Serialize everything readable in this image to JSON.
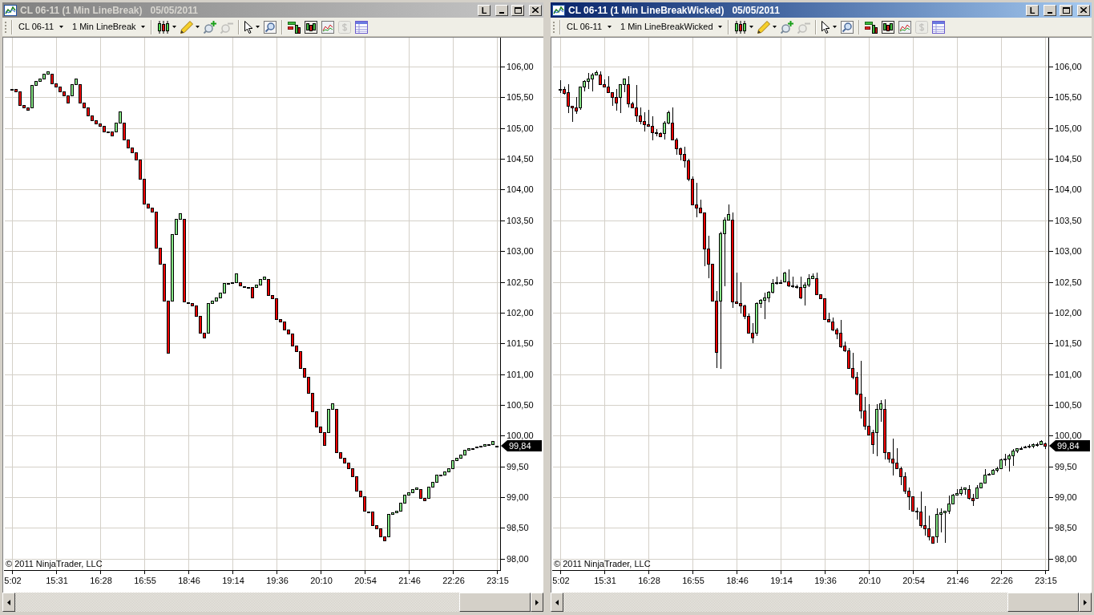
{
  "windows": [
    {
      "active": false,
      "title": "CL 06-11 (1 Min LineBreak)",
      "date": "05/05/2011",
      "caption_button": "L",
      "toolbar": {
        "instrument": "CL 06-11",
        "period": "1 Min LineBreak",
        "tool_groups": [
          [
            {
              "kind": "candles",
              "dropdown": true,
              "disabled": false
            },
            {
              "kind": "pencil",
              "dropdown": true,
              "disabled": false
            },
            {
              "kind": "zoom-in",
              "dropdown": false,
              "disabled": false
            },
            {
              "kind": "zoom-out",
              "dropdown": false,
              "disabled": true
            }
          ],
          [
            {
              "kind": "pointer",
              "dropdown": true,
              "disabled": false
            },
            {
              "kind": "data-box",
              "dropdown": false,
              "disabled": false
            }
          ],
          [
            {
              "kind": "indicators",
              "dropdown": false,
              "disabled": false
            },
            {
              "kind": "strategies",
              "dropdown": false,
              "disabled": false
            },
            {
              "kind": "chart-image",
              "dropdown": false,
              "disabled": false
            },
            {
              "kind": "dollar",
              "dropdown": false,
              "disabled": true
            },
            {
              "kind": "properties",
              "dropdown": false,
              "disabled": false
            }
          ]
        ]
      },
      "chart_data": [
        {
          "type": "candlestick",
          "grid": true,
          "ylim": [
            97.8,
            106.47
          ],
          "yticks": [
            {
              "value": 98,
              "label": "98,00"
            },
            {
              "value": 98.5,
              "label": "98,50"
            },
            {
              "value": 99,
              "label": "99,00"
            },
            {
              "value": 99.5,
              "label": "99,50"
            },
            {
              "value": 100,
              "label": "100,00"
            },
            {
              "value": 100.5,
              "label": "100,50"
            },
            {
              "value": 101,
              "label": "101,00"
            },
            {
              "value": 101.5,
              "label": "101,50"
            },
            {
              "value": 102,
              "label": "102,00"
            },
            {
              "value": 102.5,
              "label": "102,50"
            },
            {
              "value": 103,
              "label": "103,00"
            },
            {
              "value": 103.5,
              "label": "103,50"
            },
            {
              "value": 104,
              "label": "104,00"
            },
            {
              "value": 104.5,
              "label": "104,50"
            },
            {
              "value": 105,
              "label": "105,00"
            },
            {
              "value": 105.5,
              "label": "105,50"
            },
            {
              "value": 106,
              "label": "106,00"
            }
          ],
          "categories": [
            "5:02",
            null,
            null,
            null,
            null,
            null,
            null,
            null,
            null,
            null,
            null,
            "15:31",
            null,
            null,
            null,
            null,
            null,
            null,
            null,
            null,
            null,
            null,
            "16:28",
            null,
            null,
            null,
            null,
            null,
            null,
            null,
            null,
            null,
            null,
            "16:55",
            null,
            null,
            null,
            null,
            null,
            null,
            null,
            null,
            null,
            null,
            "18:46",
            null,
            null,
            null,
            null,
            null,
            null,
            null,
            null,
            null,
            null,
            "19:14",
            null,
            null,
            null,
            null,
            null,
            null,
            null,
            null,
            null,
            null,
            "19:36",
            null,
            null,
            null,
            null,
            null,
            null,
            null,
            null,
            null,
            null,
            "20:10",
            null,
            null,
            null,
            null,
            null,
            null,
            null,
            null,
            null,
            null,
            "20:54",
            null,
            null,
            null,
            null,
            null,
            null,
            null,
            null,
            null,
            null,
            "21:46",
            null,
            null,
            null,
            null,
            null,
            null,
            null,
            null,
            null,
            null,
            "22:26",
            null,
            null,
            null,
            null,
            null,
            null,
            null,
            null,
            null,
            null,
            "23:15"
          ],
          "ohlc": [
            [
              105.64,
              105.64,
              105.64,
              105.64
            ],
            [
              105.64,
              105.64,
              105.59,
              105.59
            ],
            [
              105.59,
              105.59,
              105.37,
              105.37
            ],
            [
              105.37,
              105.37,
              105.34,
              105.34
            ],
            [
              105.34,
              105.34,
              105.3,
              105.3
            ],
            [
              105.34,
              105.7,
              105.34,
              105.7
            ],
            [
              105.7,
              105.77,
              105.7,
              105.77
            ],
            [
              105.77,
              105.81,
              105.77,
              105.81
            ],
            [
              105.81,
              105.88,
              105.81,
              105.88
            ],
            [
              105.88,
              105.92,
              105.88,
              105.92
            ],
            [
              105.88,
              105.88,
              105.73,
              105.73
            ],
            [
              105.73,
              105.73,
              105.68,
              105.68
            ],
            [
              105.68,
              105.68,
              105.59,
              105.59
            ],
            [
              105.59,
              105.59,
              105.53,
              105.53
            ],
            [
              105.53,
              105.53,
              105.42,
              105.42
            ],
            [
              105.53,
              105.72,
              105.53,
              105.72
            ],
            [
              105.72,
              105.81,
              105.72,
              105.81
            ],
            [
              105.72,
              105.72,
              105.41,
              105.41
            ],
            [
              105.41,
              105.41,
              105.34,
              105.34
            ],
            [
              105.34,
              105.34,
              105.21,
              105.21
            ],
            [
              105.21,
              105.21,
              105.13,
              105.13
            ],
            [
              105.13,
              105.13,
              105.07,
              105.07
            ],
            [
              105.07,
              105.07,
              105.03,
              105.03
            ],
            [
              105.03,
              105.03,
              104.95,
              104.95
            ],
            [
              104.95,
              104.95,
              104.95,
              104.95
            ],
            [
              104.94,
              104.94,
              104.88,
              104.88
            ],
            [
              104.94,
              105.09,
              104.94,
              105.09
            ],
            [
              105.09,
              105.27,
              105.09,
              105.27
            ],
            [
              105.09,
              105.09,
              104.82,
              104.82
            ],
            [
              104.82,
              104.82,
              104.69,
              104.69
            ],
            [
              104.69,
              104.69,
              104.6,
              104.6
            ],
            [
              104.6,
              104.6,
              104.49,
              104.49
            ],
            [
              104.49,
              104.49,
              104.18,
              104.18
            ],
            [
              104.18,
              104.18,
              103.77,
              103.77
            ],
            [
              103.77,
              103.77,
              103.71,
              103.71
            ],
            [
              103.71,
              103.71,
              103.64,
              103.64
            ],
            [
              103.64,
              103.64,
              103.05,
              103.05
            ],
            [
              103.05,
              103.05,
              102.79,
              102.79
            ],
            [
              102.79,
              102.79,
              102.19,
              102.19
            ],
            [
              102.19,
              102.19,
              101.35,
              101.35
            ],
            [
              102.19,
              103.28,
              102.19,
              103.28
            ],
            [
              103.28,
              103.52,
              103.28,
              103.52
            ],
            [
              103.52,
              103.61,
              103.52,
              103.61
            ],
            [
              103.52,
              103.52,
              102.18,
              102.18
            ],
            [
              102.17,
              102.17,
              102.17,
              102.17
            ],
            [
              102.16,
              102.16,
              102.11,
              102.11
            ],
            [
              102.11,
              102.11,
              101.94,
              101.94
            ],
            [
              101.94,
              101.94,
              101.67,
              101.67
            ],
            [
              101.67,
              101.67,
              101.59,
              101.59
            ],
            [
              101.67,
              102.16,
              101.67,
              102.16
            ],
            [
              102.16,
              102.2,
              102.16,
              102.2
            ],
            [
              102.2,
              102.24,
              102.2,
              102.24
            ],
            [
              102.24,
              102.33,
              102.24,
              102.33
            ],
            [
              102.33,
              102.48,
              102.33,
              102.48
            ],
            [
              102.48,
              102.48,
              102.48,
              102.48
            ],
            [
              102.49,
              102.49,
              102.49,
              102.49
            ],
            [
              102.5,
              102.64,
              102.5,
              102.64
            ],
            [
              102.5,
              102.5,
              102.44,
              102.44
            ],
            [
              102.43,
              102.43,
              102.43,
              102.43
            ],
            [
              102.42,
              102.42,
              102.42,
              102.42
            ],
            [
              102.41,
              102.41,
              102.24,
              102.24
            ],
            [
              102.41,
              102.46,
              102.41,
              102.46
            ],
            [
              102.46,
              102.55,
              102.46,
              102.55
            ],
            [
              102.55,
              102.59,
              102.55,
              102.59
            ],
            [
              102.55,
              102.55,
              102.29,
              102.29
            ],
            [
              102.29,
              102.29,
              102.23,
              102.23
            ],
            [
              102.23,
              102.23,
              101.89,
              101.89
            ],
            [
              101.89,
              101.89,
              101.85,
              101.85
            ],
            [
              101.85,
              101.85,
              101.73,
              101.73
            ],
            [
              101.73,
              101.73,
              101.66,
              101.66
            ],
            [
              101.66,
              101.66,
              101.47,
              101.47
            ],
            [
              101.47,
              101.47,
              101.37,
              101.37
            ],
            [
              101.37,
              101.37,
              101.1,
              101.1
            ],
            [
              101.1,
              101.1,
              100.95,
              100.95
            ],
            [
              100.95,
              100.95,
              100.69,
              100.69
            ],
            [
              100.69,
              100.69,
              100.4,
              100.4
            ],
            [
              100.4,
              100.4,
              100.15,
              100.15
            ],
            [
              100.15,
              100.15,
              100.05,
              100.05
            ],
            [
              100.05,
              100.05,
              99.85,
              99.85
            ],
            [
              100.05,
              100.43,
              100.05,
              100.43
            ],
            [
              100.43,
              100.52,
              100.43,
              100.52
            ],
            [
              100.43,
              100.43,
              99.73,
              99.73
            ],
            [
              99.73,
              99.73,
              99.64,
              99.64
            ],
            [
              99.64,
              99.64,
              99.56,
              99.56
            ],
            [
              99.56,
              99.56,
              99.47,
              99.47
            ],
            [
              99.47,
              99.47,
              99.34,
              99.34
            ],
            [
              99.34,
              99.34,
              99.1,
              99.1
            ],
            [
              99.1,
              99.1,
              99.01,
              99.01
            ],
            [
              99.01,
              99.01,
              98.78,
              98.78
            ],
            [
              98.77,
              98.77,
              98.77,
              98.77
            ],
            [
              98.77,
              98.77,
              98.54,
              98.54
            ],
            [
              98.54,
              98.54,
              98.49,
              98.49
            ],
            [
              98.49,
              98.49,
              98.36,
              98.36
            ],
            [
              98.36,
              98.36,
              98.29,
              98.29
            ],
            [
              98.36,
              98.73,
              98.36,
              98.73
            ],
            [
              98.73,
              98.75,
              98.73,
              98.75
            ],
            [
              98.75,
              98.78,
              98.75,
              98.78
            ],
            [
              98.78,
              98.91,
              98.78,
              98.91
            ],
            [
              98.91,
              99.04,
              98.91,
              99.04
            ],
            [
              99.04,
              99.08,
              99.04,
              99.08
            ],
            [
              99.08,
              99.13,
              99.08,
              99.13
            ],
            [
              99.13,
              99.16,
              99.13,
              99.16
            ],
            [
              99.13,
              99.13,
              98.99,
              98.99
            ],
            [
              98.99,
              98.99,
              98.95,
              98.95
            ],
            [
              98.99,
              99.17,
              98.99,
              99.17
            ],
            [
              99.17,
              99.25,
              99.17,
              99.25
            ],
            [
              99.25,
              99.36,
              99.25,
              99.36
            ],
            [
              99.37,
              99.37,
              99.37,
              99.37
            ],
            [
              99.37,
              99.42,
              99.37,
              99.42
            ],
            [
              99.42,
              99.47,
              99.42,
              99.47
            ],
            [
              99.47,
              99.6,
              99.47,
              99.6
            ],
            [
              99.6,
              99.64,
              99.6,
              99.64
            ],
            [
              99.64,
              99.69,
              99.64,
              99.69
            ],
            [
              99.69,
              99.77,
              99.69,
              99.77
            ],
            [
              99.77,
              99.79,
              99.77,
              99.79
            ],
            [
              99.8,
              99.8,
              99.8,
              99.8
            ],
            [
              99.82,
              99.82,
              99.82,
              99.82
            ],
            [
              99.83,
              99.83,
              99.83,
              99.83
            ],
            [
              99.83,
              99.86,
              99.83,
              99.86
            ],
            [
              99.86,
              99.86,
              99.86,
              99.86
            ],
            [
              99.86,
              99.91,
              99.86,
              99.91
            ],
            [
              99.84,
              99.84,
              99.84,
              99.84
            ]
          ],
          "annotations": [
            "99,84"
          ]
        }
      ],
      "copyright_notice": "© 2011 NinjaTrader, LLC"
    },
    {
      "active": true,
      "title": "CL 06-11 (1 Min LineBreakWicked)",
      "date": "05/05/2011",
      "caption_button": "L",
      "toolbar": {
        "instrument": "CL 06-11",
        "period": "1 Min LineBreakWicked",
        "tool_groups": [
          [
            {
              "kind": "candles",
              "dropdown": true,
              "disabled": false
            },
            {
              "kind": "pencil",
              "dropdown": true,
              "disabled": false
            },
            {
              "kind": "zoom-in",
              "dropdown": false,
              "disabled": false
            },
            {
              "kind": "zoom-out",
              "dropdown": false,
              "disabled": true
            }
          ],
          [
            {
              "kind": "pointer",
              "dropdown": true,
              "disabled": false
            },
            {
              "kind": "data-box",
              "dropdown": false,
              "disabled": false
            }
          ],
          [
            {
              "kind": "indicators",
              "dropdown": false,
              "disabled": false
            },
            {
              "kind": "strategies",
              "dropdown": false,
              "disabled": false
            },
            {
              "kind": "chart-image",
              "dropdown": false,
              "disabled": false
            },
            {
              "kind": "dollar",
              "dropdown": false,
              "disabled": true
            },
            {
              "kind": "properties",
              "dropdown": false,
              "disabled": false
            }
          ]
        ]
      },
      "chart_data": [
        {
          "type": "candlestick",
          "grid": true,
          "ylim": [
            97.8,
            106.47
          ],
          "yticks": [
            {
              "value": 98,
              "label": "98,00"
            },
            {
              "value": 98.5,
              "label": "98,50"
            },
            {
              "value": 99,
              "label": "99,00"
            },
            {
              "value": 99.5,
              "label": "99,50"
            },
            {
              "value": 100,
              "label": "100,00"
            },
            {
              "value": 100.5,
              "label": "100,50"
            },
            {
              "value": 101,
              "label": "101,00"
            },
            {
              "value": 101.5,
              "label": "101,50"
            },
            {
              "value": 102,
              "label": "102,00"
            },
            {
              "value": 102.5,
              "label": "102,50"
            },
            {
              "value": 103,
              "label": "103,00"
            },
            {
              "value": 103.5,
              "label": "103,50"
            },
            {
              "value": 104,
              "label": "104,00"
            },
            {
              "value": 104.5,
              "label": "104,50"
            },
            {
              "value": 105,
              "label": "105,00"
            },
            {
              "value": 105.5,
              "label": "105,50"
            },
            {
              "value": 106,
              "label": "106,00"
            }
          ],
          "categories": [
            "5:02",
            null,
            null,
            null,
            null,
            null,
            null,
            null,
            null,
            null,
            null,
            "15:31",
            null,
            null,
            null,
            null,
            null,
            null,
            null,
            null,
            null,
            null,
            "16:28",
            null,
            null,
            null,
            null,
            null,
            null,
            null,
            null,
            null,
            null,
            "16:55",
            null,
            null,
            null,
            null,
            null,
            null,
            null,
            null,
            null,
            null,
            "18:46",
            null,
            null,
            null,
            null,
            null,
            null,
            null,
            null,
            null,
            null,
            "19:14",
            null,
            null,
            null,
            null,
            null,
            null,
            null,
            null,
            null,
            null,
            "19:36",
            null,
            null,
            null,
            null,
            null,
            null,
            null,
            null,
            null,
            null,
            "20:10",
            null,
            null,
            null,
            null,
            null,
            null,
            null,
            null,
            null,
            null,
            "20:54",
            null,
            null,
            null,
            null,
            null,
            null,
            null,
            null,
            null,
            null,
            "21:46",
            null,
            null,
            null,
            null,
            null,
            null,
            null,
            null,
            null,
            null,
            "22:26",
            null,
            null,
            null,
            null,
            null,
            null,
            null,
            null,
            null,
            null,
            "23:15"
          ],
          "ohlc": [
            [
              105.63,
              105.78,
              105.57,
              105.63
            ],
            [
              105.63,
              105.67,
              105.54,
              105.57
            ],
            [
              105.58,
              105.71,
              105.25,
              105.36
            ],
            [
              105.36,
              105.36,
              105.1,
              105.33
            ],
            [
              105.33,
              105.51,
              105.23,
              105.29
            ],
            [
              105.33,
              105.68,
              105.3,
              105.68
            ],
            [
              105.68,
              105.78,
              105.6,
              105.76
            ],
            [
              105.76,
              105.89,
              105.64,
              105.8
            ],
            [
              105.8,
              105.89,
              105.59,
              105.87
            ],
            [
              105.87,
              105.93,
              105.87,
              105.91
            ],
            [
              105.87,
              105.92,
              105.72,
              105.72
            ],
            [
              105.72,
              105.79,
              105.66,
              105.67
            ],
            [
              105.67,
              105.85,
              105.58,
              105.58
            ],
            [
              105.58,
              105.58,
              105.36,
              105.51
            ],
            [
              105.51,
              105.63,
              105.29,
              105.41
            ],
            [
              105.51,
              105.71,
              105.25,
              105.71
            ],
            [
              105.71,
              105.81,
              105.58,
              105.8
            ],
            [
              105.71,
              105.84,
              105.33,
              105.4
            ],
            [
              105.4,
              105.43,
              105.33,
              105.33
            ],
            [
              105.33,
              105.7,
              105.1,
              105.2
            ],
            [
              105.2,
              105.34,
              105.06,
              105.12
            ],
            [
              105.12,
              105.26,
              104.95,
              105.06
            ],
            [
              105.06,
              105.3,
              105.03,
              105.03
            ],
            [
              105.03,
              105.19,
              104.8,
              104.93
            ],
            [
              104.93,
              104.99,
              104.86,
              104.93
            ],
            [
              104.92,
              104.93,
              104.87,
              104.87
            ],
            [
              104.92,
              105.11,
              104.82,
              105.09
            ],
            [
              105.09,
              105.28,
              105.06,
              105.26
            ],
            [
              105.09,
              105.33,
              104.82,
              104.82
            ],
            [
              104.82,
              104.84,
              104.57,
              104.67
            ],
            [
              104.67,
              104.69,
              104.48,
              104.58
            ],
            [
              104.58,
              104.7,
              104.36,
              104.48
            ],
            [
              104.48,
              104.5,
              104.14,
              104.18
            ],
            [
              104.18,
              104.22,
              103.75,
              103.76
            ],
            [
              103.76,
              104.11,
              103.55,
              103.71
            ],
            [
              103.71,
              103.83,
              103.61,
              103.63
            ],
            [
              103.63,
              103.63,
              102.75,
              103.04
            ],
            [
              103.04,
              103.25,
              102.56,
              102.79
            ],
            [
              102.79,
              102.79,
              102.18,
              102.19
            ],
            [
              102.19,
              102.35,
              101.1,
              101.36
            ],
            [
              102.19,
              103.31,
              101.08,
              103.29
            ],
            [
              103.29,
              103.55,
              102.43,
              103.51
            ],
            [
              103.51,
              103.76,
              103.5,
              103.6
            ],
            [
              103.51,
              103.63,
              102.08,
              102.18
            ],
            [
              102.18,
              102.65,
              102.14,
              102.15
            ],
            [
              102.15,
              102.5,
              101.98,
              102.11
            ],
            [
              102.11,
              102.13,
              101.9,
              101.94
            ],
            [
              101.94,
              101.98,
              101.66,
              101.67
            ],
            [
              101.67,
              101.83,
              101.5,
              101.6
            ],
            [
              101.67,
              102.17,
              101.62,
              102.15
            ],
            [
              102.15,
              102.22,
              102.07,
              102.21
            ],
            [
              102.21,
              102.32,
              101.9,
              102.25
            ],
            [
              102.25,
              102.35,
              102.17,
              102.34
            ],
            [
              102.34,
              102.55,
              102.31,
              102.48
            ],
            [
              102.49,
              102.58,
              102.45,
              102.49
            ],
            [
              102.5,
              102.53,
              102.47,
              102.5
            ],
            [
              102.51,
              102.66,
              102.5,
              102.65
            ],
            [
              102.51,
              102.7,
              102.41,
              102.44
            ],
            [
              102.44,
              102.58,
              102.4,
              102.44
            ],
            [
              102.43,
              102.45,
              102.39,
              102.43
            ],
            [
              102.41,
              102.58,
              102.22,
              102.24
            ],
            [
              102.41,
              102.49,
              102.11,
              102.45
            ],
            [
              102.45,
              102.62,
              102.41,
              102.56
            ],
            [
              102.56,
              102.64,
              102.56,
              102.6
            ],
            [
              102.56,
              102.65,
              102.3,
              102.3
            ],
            [
              102.3,
              102.3,
              102.23,
              102.23
            ],
            [
              102.23,
              102.23,
              101.89,
              101.89
            ],
            [
              101.89,
              102.0,
              101.85,
              101.85
            ],
            [
              101.85,
              101.92,
              101.7,
              101.73
            ],
            [
              101.73,
              101.75,
              101.57,
              101.66
            ],
            [
              101.67,
              101.88,
              101.43,
              101.45
            ],
            [
              101.47,
              101.53,
              101.36,
              101.39
            ],
            [
              101.39,
              101.43,
              101.1,
              101.1
            ],
            [
              101.1,
              101.35,
              100.92,
              100.95
            ],
            [
              100.95,
              101.03,
              100.65,
              100.68
            ],
            [
              100.68,
              101.21,
              100.28,
              100.41
            ],
            [
              100.41,
              100.63,
              100.1,
              100.16
            ],
            [
              100.16,
              100.51,
              100.01,
              100.01
            ],
            [
              100.05,
              100.1,
              99.71,
              99.86
            ],
            [
              100.05,
              100.51,
              99.67,
              100.43
            ],
            [
              100.43,
              100.58,
              100.22,
              100.52
            ],
            [
              100.43,
              100.59,
              99.61,
              99.73
            ],
            [
              99.73,
              99.73,
              99.56,
              99.63
            ],
            [
              99.63,
              99.95,
              99.35,
              99.56
            ],
            [
              99.56,
              99.79,
              99.45,
              99.47
            ],
            [
              99.47,
              99.49,
              99.2,
              99.34
            ],
            [
              99.34,
              99.41,
              99.05,
              99.11
            ],
            [
              99.11,
              99.16,
              98.79,
              99.01
            ],
            [
              99.01,
              99.01,
              98.78,
              98.78
            ],
            [
              98.78,
              98.83,
              98.63,
              98.78
            ],
            [
              98.77,
              99.09,
              98.51,
              98.54
            ],
            [
              98.54,
              98.86,
              98.38,
              98.49
            ],
            [
              98.49,
              98.7,
              98.3,
              98.36
            ],
            [
              98.36,
              98.36,
              98.25,
              98.26
            ],
            [
              98.36,
              98.82,
              98.25,
              98.73
            ],
            [
              98.73,
              98.82,
              98.42,
              98.75
            ],
            [
              98.75,
              98.78,
              98.26,
              98.78
            ],
            [
              98.78,
              99.02,
              98.73,
              98.9
            ],
            [
              98.9,
              99.05,
              98.88,
              99.04
            ],
            [
              99.04,
              99.13,
              99.04,
              99.07
            ],
            [
              99.07,
              99.17,
              99.03,
              99.13
            ],
            [
              99.13,
              99.16,
              99.04,
              99.16
            ],
            [
              99.13,
              99.2,
              98.96,
              98.99
            ],
            [
              98.99,
              99.05,
              98.86,
              98.95
            ],
            [
              98.99,
              99.2,
              98.97,
              99.16
            ],
            [
              99.16,
              99.24,
              99.15,
              99.24
            ],
            [
              99.24,
              99.46,
              99.23,
              99.37
            ],
            [
              99.38,
              99.39,
              99.35,
              99.38
            ],
            [
              99.38,
              99.46,
              99.37,
              99.44
            ],
            [
              99.44,
              99.49,
              99.41,
              99.47
            ],
            [
              99.47,
              99.62,
              99.46,
              99.61
            ],
            [
              99.61,
              99.71,
              99.51,
              99.63
            ],
            [
              99.63,
              99.71,
              99.42,
              99.68
            ],
            [
              99.68,
              99.78,
              99.51,
              99.76
            ],
            [
              99.76,
              99.8,
              99.72,
              99.79
            ],
            [
              99.8,
              99.82,
              99.79,
              99.8
            ],
            [
              99.82,
              99.84,
              99.79,
              99.82
            ],
            [
              99.83,
              99.86,
              99.8,
              99.83
            ],
            [
              99.83,
              99.87,
              99.8,
              99.86
            ],
            [
              99.86,
              99.89,
              99.82,
              99.86
            ],
            [
              99.86,
              99.92,
              99.86,
              99.91
            ],
            [
              99.87,
              99.89,
              99.78,
              99.84
            ]
          ],
          "annotations": [
            "99,84"
          ]
        }
      ],
      "copyright_notice": "© 2011 NinjaTrader, LLC"
    }
  ]
}
